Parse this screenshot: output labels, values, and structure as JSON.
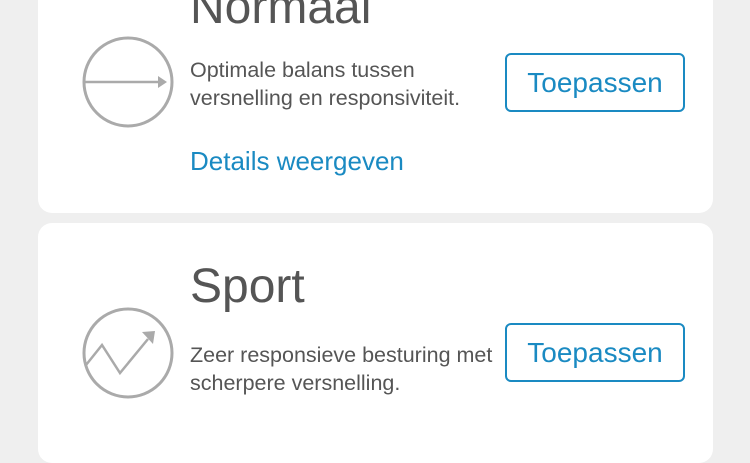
{
  "modes": {
    "normal": {
      "title": "Normaal",
      "description": "Optimale balans tussen versnelling en responsiviteit.",
      "details_link": "Details weergeven",
      "apply_label": "Toepassen",
      "icon": "arrow-right-icon"
    },
    "sport": {
      "title": "Sport",
      "description": "Zeer responsieve besturing met scherpere versnelling.",
      "apply_label": "Toepassen",
      "icon": "zigzag-arrow-icon"
    }
  },
  "colors": {
    "accent": "#1a8ac2",
    "text": "#555555",
    "icon": "#aaaaaa",
    "background": "#efefef",
    "card": "#ffffff"
  }
}
